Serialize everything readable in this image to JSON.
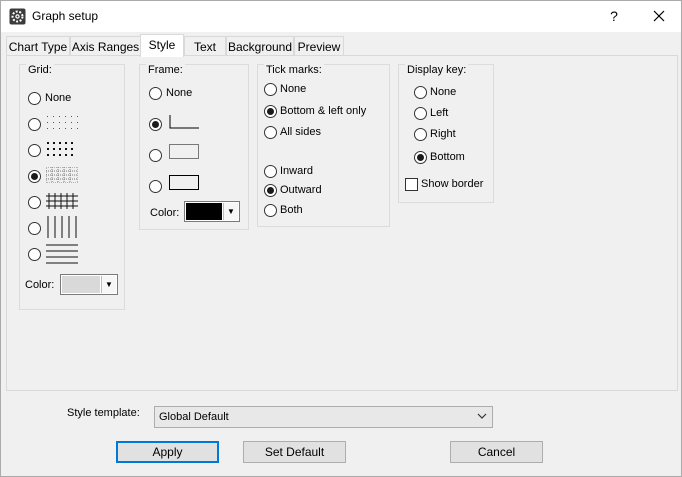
{
  "window": {
    "title": "Graph setup",
    "help": "?"
  },
  "tabs": [
    {
      "label": "Chart Type"
    },
    {
      "label": "Axis Ranges"
    },
    {
      "label": "Style",
      "active": true
    },
    {
      "label": "Text"
    },
    {
      "label": "Background"
    },
    {
      "label": "Preview"
    }
  ],
  "grid": {
    "label": "Grid:",
    "options": [
      {
        "label": "None",
        "checked": false
      },
      {
        "pattern": "sparse-dots",
        "checked": false
      },
      {
        "pattern": "dense-dots",
        "checked": false
      },
      {
        "pattern": "fine-dot-grid",
        "checked": true
      },
      {
        "pattern": "solid-grid",
        "checked": false
      },
      {
        "pattern": "vertical-lines",
        "checked": false
      },
      {
        "pattern": "horizontal-lines",
        "checked": false
      }
    ],
    "color_label": "Color:",
    "color": "#d9d9d9"
  },
  "frame": {
    "label": "Frame:",
    "options": [
      {
        "label": "None",
        "checked": false
      },
      {
        "pattern": "bottom-left-frame",
        "checked": true
      },
      {
        "pattern": "dotted-box-frame",
        "checked": false
      },
      {
        "pattern": "solid-box-frame",
        "checked": false
      }
    ],
    "color_label": "Color:",
    "color": "#000000"
  },
  "tick_marks": {
    "label": "Tick marks:",
    "placement": [
      {
        "label": "None",
        "checked": false
      },
      {
        "label": "Bottom & left only",
        "checked": true
      },
      {
        "label": "All sides",
        "checked": false
      }
    ],
    "direction": [
      {
        "label": "Inward",
        "checked": false
      },
      {
        "label": "Outward",
        "checked": true
      },
      {
        "label": "Both",
        "checked": false
      }
    ]
  },
  "display_key": {
    "label": "Display key:",
    "options": [
      {
        "label": "None",
        "checked": false
      },
      {
        "label": "Left",
        "checked": false
      },
      {
        "label": "Right",
        "checked": false
      },
      {
        "label": "Bottom",
        "checked": true
      }
    ],
    "show_border_label": "Show border",
    "show_border": false
  },
  "style_template": {
    "label": "Style template:",
    "value": "Global Default"
  },
  "buttons": {
    "apply": "Apply",
    "set_default": "Set Default",
    "cancel": "Cancel"
  },
  "colors": {
    "accent": "#0078d7"
  }
}
